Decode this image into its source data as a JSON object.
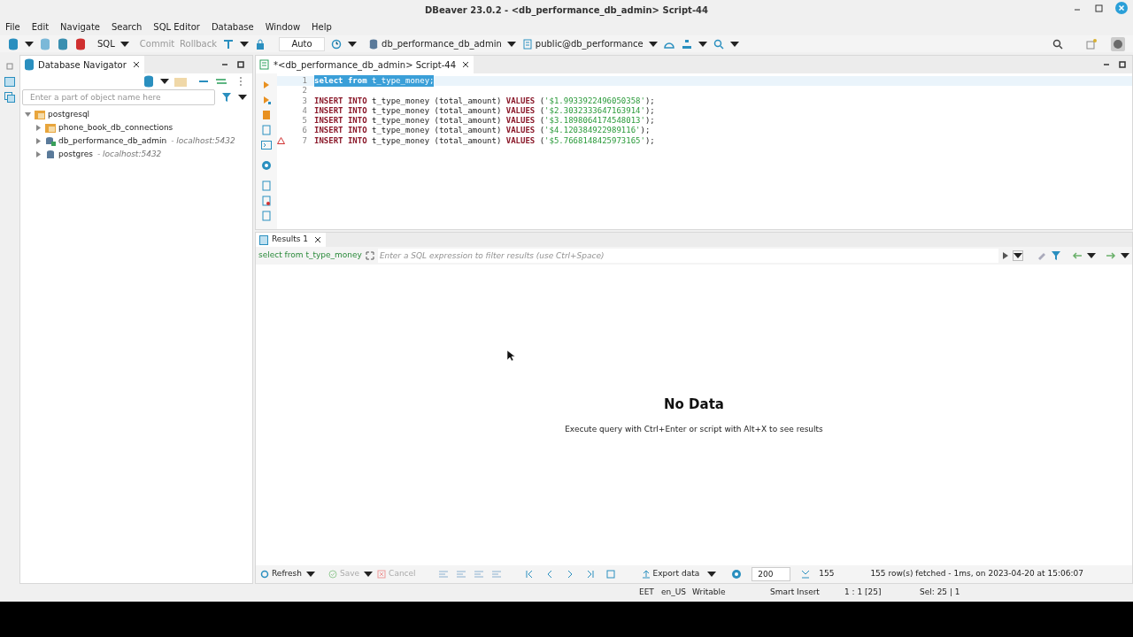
{
  "window": {
    "title": "DBeaver 23.0.2 - <db_performance_db_admin> Script-44"
  },
  "menu": [
    "File",
    "Edit",
    "Navigate",
    "Search",
    "SQL Editor",
    "Database",
    "Window",
    "Help"
  ],
  "toolbar": {
    "sql": "SQL",
    "commit": {
      "label": "Commit",
      "disabled": true
    },
    "rollback": {
      "label": "Rollback",
      "disabled": true
    },
    "mode": "Auto",
    "datasource": "db_performance_db_admin",
    "schema": "public@db_performance"
  },
  "navigator": {
    "title": "Database Navigator",
    "filter": {
      "placeholder": "Enter a part of object name here"
    },
    "tree": [
      {
        "label": "postgresql",
        "kind": "folder",
        "expanded": true,
        "children": [
          {
            "label": "phone_book_db_connections",
            "kind": "folder",
            "expanded": false
          },
          {
            "label": "db_performance_db_admin",
            "kind": "connected",
            "host": "- localhost:5432",
            "expanded": false
          },
          {
            "label": "postgres",
            "kind": "db",
            "host": "- localhost:5432",
            "expanded": false
          }
        ]
      }
    ]
  },
  "editor": {
    "tab": "*<db_performance_db_admin> Script-44",
    "lines": [
      {
        "number": "1",
        "selected": true,
        "warning": false,
        "tokens": [
          {
            "kind": "keyword",
            "text": "select from"
          },
          {
            "kind": "plain",
            "text": " t_type_money;"
          }
        ]
      },
      {
        "number": "2",
        "selected": false,
        "warning": false
      },
      {
        "number": "3",
        "selected": false,
        "warning": false,
        "tokens": [
          {
            "kind": "keyword",
            "text": "INSERT INTO"
          },
          {
            "kind": "plain",
            "text": " t_type_money (total_amount) "
          },
          {
            "kind": "keyword",
            "text": "VALUES"
          },
          {
            "kind": "plain",
            "text": " ("
          },
          {
            "kind": "string",
            "text": "'$1.9933922496050358'"
          },
          {
            "kind": "plain",
            "text": ");"
          }
        ]
      },
      {
        "number": "4",
        "selected": false,
        "warning": false,
        "tokens": [
          {
            "kind": "keyword",
            "text": "INSERT INTO"
          },
          {
            "kind": "plain",
            "text": " t_type_money (total_amount) "
          },
          {
            "kind": "keyword",
            "text": "VALUES"
          },
          {
            "kind": "plain",
            "text": " ("
          },
          {
            "kind": "string",
            "text": "'$2.3032333647163914'"
          },
          {
            "kind": "plain",
            "text": ");"
          }
        ]
      },
      {
        "number": "5",
        "selected": false,
        "warning": false,
        "tokens": [
          {
            "kind": "keyword",
            "text": "INSERT INTO"
          },
          {
            "kind": "plain",
            "text": " t_type_money (total_amount) "
          },
          {
            "kind": "keyword",
            "text": "VALUES"
          },
          {
            "kind": "plain",
            "text": " ("
          },
          {
            "kind": "string",
            "text": "'$3.1898064174548013'"
          },
          {
            "kind": "plain",
            "text": ");"
          }
        ]
      },
      {
        "number": "6",
        "selected": false,
        "warning": false,
        "tokens": [
          {
            "kind": "keyword",
            "text": "INSERT INTO"
          },
          {
            "kind": "plain",
            "text": " t_type_money (total_amount) "
          },
          {
            "kind": "keyword",
            "text": "VALUES"
          },
          {
            "kind": "plain",
            "text": " ("
          },
          {
            "kind": "string",
            "text": "'$4.120384922989116'"
          },
          {
            "kind": "plain",
            "text": ");"
          }
        ]
      },
      {
        "number": "7",
        "selected": false,
        "warning": true,
        "tokens": [
          {
            "kind": "keyword",
            "text": "INSERT INTO"
          },
          {
            "kind": "plain",
            "text": " t_type_money (total_amount) "
          },
          {
            "kind": "keyword",
            "text": "VALUES"
          },
          {
            "kind": "plain",
            "text": " ("
          },
          {
            "kind": "string",
            "text": "'$5.7668148425973165'"
          },
          {
            "kind": "plain",
            "text": ");"
          }
        ]
      }
    ]
  },
  "results": {
    "tab": "Results 1",
    "query": "select from t_type_money",
    "filter": {
      "placeholder": "Enter a SQL expression to filter results (use Ctrl+Space)"
    },
    "empty_title": "No Data",
    "empty_hint": "Execute query with Ctrl+Enter or script with Alt+X to see results",
    "refresh": "Refresh",
    "save": {
      "label": "Save",
      "disabled": true
    },
    "cancel": {
      "label": "Cancel",
      "disabled": true
    },
    "export": "Export data",
    "fetch_size": "200",
    "row_count": "155",
    "message": "155 row(s) fetched - 1ms, on 2023-04-20 at 15:06:07"
  },
  "status_bar": [
    "EET",
    "en_US",
    "Writable",
    "Smart Insert",
    "1 : 1 [25]",
    "Sel: 25 | 1"
  ]
}
